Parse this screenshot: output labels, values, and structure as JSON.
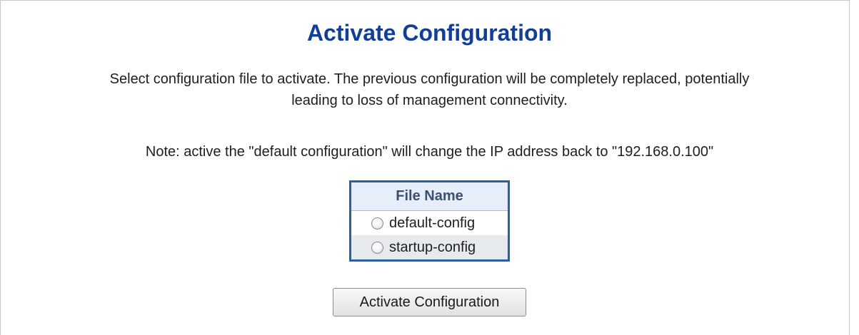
{
  "page": {
    "title": "Activate Configuration",
    "description_line1": "Select configuration file to activate. The previous configuration will be completely replaced, potentially",
    "description_line2": "leading to loss of management connectivity.",
    "note": "Note: active the \"default configuration\" will change the IP address back to \"192.168.0.100\""
  },
  "file_table": {
    "header": "File Name",
    "files": [
      {
        "label": "default-config",
        "selected": false
      },
      {
        "label": "startup-config",
        "selected": false
      }
    ]
  },
  "actions": {
    "activate_label": "Activate Configuration"
  },
  "colors": {
    "title": "#123f96",
    "table_border": "#2b5f9e",
    "header_bg": "#e6eefa"
  }
}
